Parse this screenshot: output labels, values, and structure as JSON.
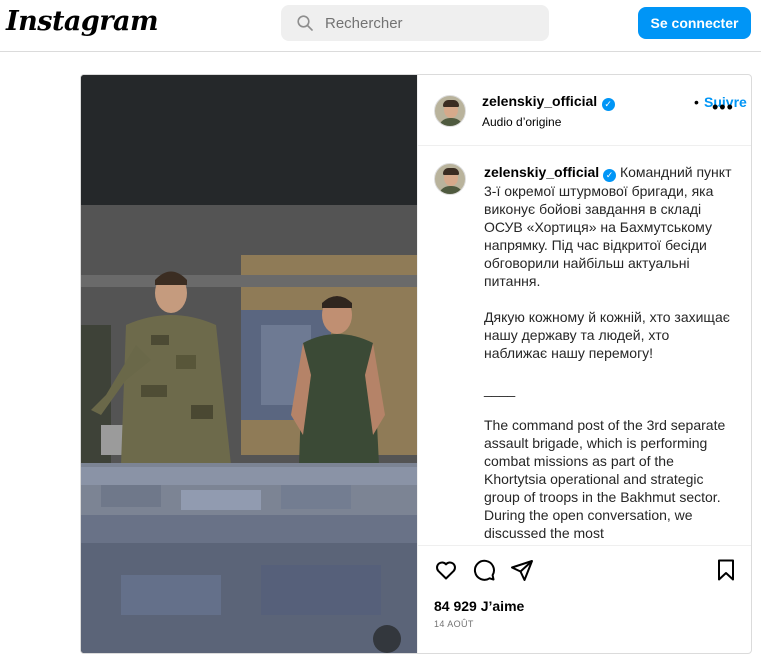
{
  "header": {
    "logo": "Instagram",
    "search_placeholder": "Rechercher",
    "login_label": "Se connecter"
  },
  "post": {
    "username": "zelenskiy_official",
    "follow_label": "Suivre",
    "audio_label": "Audio d’origine",
    "caption_username": "zelenskiy_official",
    "caption_p1": "Командний пункт 3-ї окремої штурмової бригади, яка виконує бойові завдання в складі ОСУВ «Хортиця» на Бахмутському напрямку. Під час відкритої бесіди обговорили найбільш актуальні питання.",
    "caption_p2": "Дякую кожному й кожній, хто захищає нашу державу та людей, хто наближає нашу перемогу!",
    "caption_p3": "____",
    "caption_p4": "The command post of the 3rd separate assault brigade, which is performing combat missions as part of the Khortytsia operational and strategic group of troops in the Bakhmut sector. During the open conversation, we discussed the most",
    "likes_count": "84 929",
    "likes_label": "J’aime",
    "date": "14 AOÛT"
  },
  "colors": {
    "accent": "#0095f6",
    "border": "#dbdbdb",
    "muted": "#737373"
  },
  "icons": [
    "search-icon",
    "verified-badge-icon",
    "more-options-icon",
    "heart-icon",
    "comment-icon",
    "share-icon",
    "bookmark-icon"
  ]
}
